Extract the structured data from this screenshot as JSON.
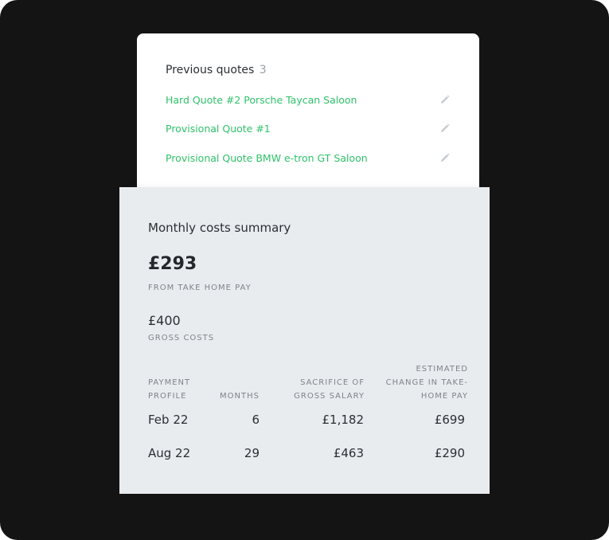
{
  "previous_quotes": {
    "title": "Previous quotes",
    "count": "3",
    "items": [
      {
        "label": "Hard Quote #2 Porsche Taycan Saloon",
        "icon": "pencil-icon"
      },
      {
        "label": "Provisional Quote #1",
        "icon": "pencil-icon"
      },
      {
        "label": "Provisional Quote BMW e-tron GT Saloon",
        "icon": "pencil-icon"
      }
    ]
  },
  "summary": {
    "title": "Monthly costs summary",
    "take_home_amount": "£293",
    "take_home_label": "FROM TAKE HOME PAY",
    "gross_amount": "£400",
    "gross_label": "GROSS COSTS",
    "table": {
      "headers": [
        "PAYMENT\nPROFILE",
        "MONTHS",
        "SACRIFICE OF\nGROSS SALARY",
        "ESTIMATED\nCHANGE IN TAKE-\nHOME PAY"
      ],
      "rows": [
        [
          "Feb 22",
          "6",
          "£1,182",
          "£699"
        ],
        [
          "Aug 22",
          "29",
          "£463",
          "£290"
        ]
      ]
    }
  },
  "colors": {
    "frame": "#141414",
    "link": "#2fc26a",
    "summary_bg": "#e9ecef"
  }
}
